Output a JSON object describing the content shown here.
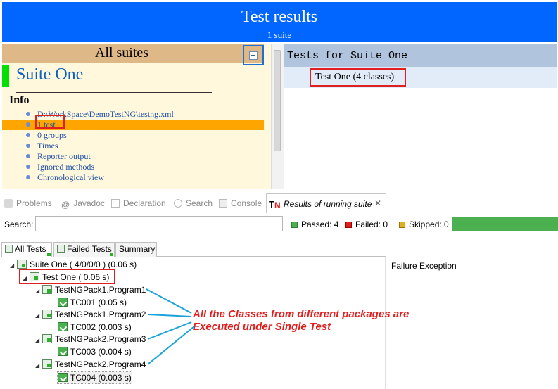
{
  "report": {
    "title": "Test results",
    "subtitle": "1 suite",
    "all_suites_label": "All suites",
    "suite_name": "Suite One",
    "info_heading": "Info",
    "info_items": [
      "D:\\WorkSpace\\DemoTestNG\\testng.xml",
      "1 test",
      "0 groups",
      "Times",
      "Reporter output",
      "Ignored methods",
      "Chronological view"
    ],
    "tests_heading": "Tests for Suite One",
    "test_entry": "Test One (4 classes)"
  },
  "view_tabs": [
    "Problems",
    "Javadoc",
    "Declaration",
    "Search",
    "Console",
    "Results of running suite"
  ],
  "toolbar": {
    "search_label": "Search:",
    "search_value": "",
    "passed": "Passed: 4",
    "failed": "Failed: 0",
    "skipped": "Skipped: 0",
    "progress_fraction": 1.0
  },
  "colors": {
    "passed": "#4caf50",
    "failed": "#e02020",
    "skipped": "#e0b020",
    "banner": "#0066ff",
    "annotation": "#e02020"
  },
  "sub_tabs": [
    "All Tests",
    "Failed Tests",
    "Summary"
  ],
  "tree": {
    "suite": "Suite One ( 4/0/0/0 ) (0.06 s)",
    "test": "Test One ( 0.06 s)",
    "classes": [
      {
        "name": "TestNGPack1.Program1",
        "method": "TC001  (0.05 s)"
      },
      {
        "name": "TestNGPack1.Program2",
        "method": "TC002  (0.003 s)"
      },
      {
        "name": "TestNGPack2.Program3",
        "method": "TC003  (0.004 s)"
      },
      {
        "name": "TestNGPack2.Program4",
        "method": "TC004  (0.003 s)"
      }
    ]
  },
  "failure_exception_label": "Failure Exception",
  "annotation": {
    "line1": "All the Classes from different packages are",
    "line2": "Executed under Single Test"
  }
}
